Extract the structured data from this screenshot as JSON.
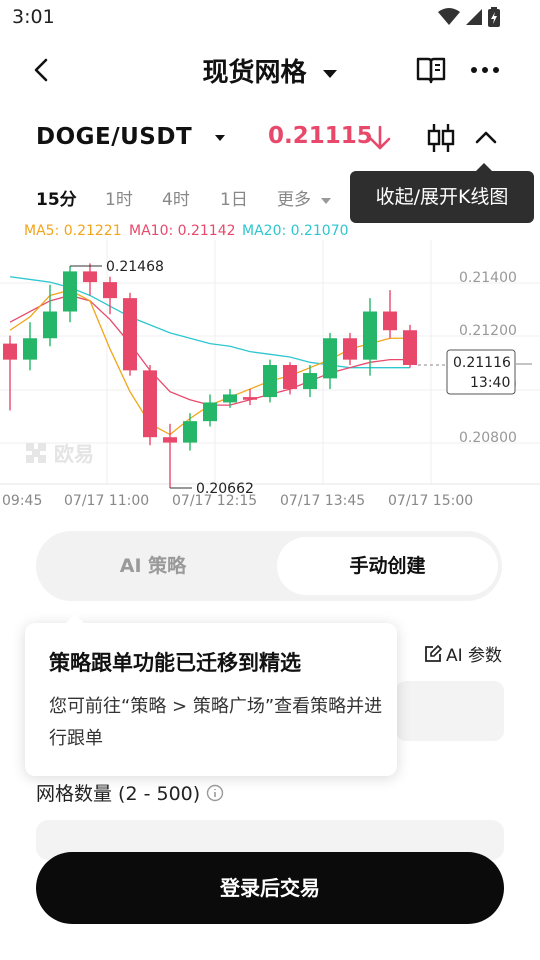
{
  "status_bar": {
    "time": "3:01"
  },
  "header": {
    "title": "现货网格"
  },
  "pair_bar": {
    "pair": "DOGE/USDT",
    "price": "0.21115"
  },
  "timeframes": {
    "tf_15m": "15分",
    "tf_1h": "1时",
    "tf_4h": "4时",
    "tf_1d": "1日",
    "more": "更多"
  },
  "tooltip": {
    "text": "收起/展开K线图"
  },
  "indicators": {
    "ma5": "MA5: 0.21221",
    "ma10": "MA10: 0.21142",
    "ma20": "MA20: 0.21070"
  },
  "colors": {
    "up": "#25b669",
    "down": "#e8496b",
    "ma5": "#f2a51a",
    "ma10": "#e8496b",
    "ma20": "#2ec6d0"
  },
  "chart_data": {
    "type": "candlestick",
    "y_ticks": [
      "0.21400",
      "0.21200",
      "0.21100",
      "0.20800"
    ],
    "x_ticks": [
      "09:45",
      "07/17 11:00",
      "07/17 12:15",
      "07/17 13:45",
      "07/17 15:00"
    ],
    "high_label": "0.21468",
    "low_label": "0.20662",
    "current_price": "0.21116",
    "current_countdown": "13:40",
    "watermark": "欧易",
    "ylim": [
      0.2069,
      0.2155
    ],
    "candles": [
      {
        "o": 0.212,
        "c": 0.2114,
        "h": 0.2123,
        "l": 0.2095
      },
      {
        "o": 0.2114,
        "c": 0.2122,
        "h": 0.2128,
        "l": 0.211
      },
      {
        "o": 0.2122,
        "c": 0.2132,
        "h": 0.2142,
        "l": 0.2119
      },
      {
        "o": 0.2132,
        "c": 0.2147,
        "h": 0.2149,
        "l": 0.2128
      },
      {
        "o": 0.2147,
        "c": 0.2143,
        "h": 0.215,
        "l": 0.2138
      },
      {
        "o": 0.2143,
        "c": 0.2137,
        "h": 0.2145,
        "l": 0.2131
      },
      {
        "o": 0.2137,
        "c": 0.211,
        "h": 0.2139,
        "l": 0.2108
      },
      {
        "o": 0.211,
        "c": 0.2085,
        "h": 0.2112,
        "l": 0.2082
      },
      {
        "o": 0.2085,
        "c": 0.2083,
        "h": 0.209,
        "l": 0.2066
      },
      {
        "o": 0.2083,
        "c": 0.2091,
        "h": 0.2094,
        "l": 0.208
      },
      {
        "o": 0.2091,
        "c": 0.2098,
        "h": 0.2101,
        "l": 0.2089
      },
      {
        "o": 0.2098,
        "c": 0.2101,
        "h": 0.2103,
        "l": 0.2096
      },
      {
        "o": 0.21,
        "c": 0.2099,
        "h": 0.2103,
        "l": 0.2097
      },
      {
        "o": 0.21,
        "c": 0.2112,
        "h": 0.2114,
        "l": 0.2098
      },
      {
        "o": 0.2112,
        "c": 0.2103,
        "h": 0.2113,
        "l": 0.2101
      },
      {
        "o": 0.2103,
        "c": 0.2109,
        "h": 0.2112,
        "l": 0.21
      },
      {
        "o": 0.2107,
        "c": 0.2122,
        "h": 0.2124,
        "l": 0.2103
      },
      {
        "o": 0.2122,
        "c": 0.2114,
        "h": 0.2124,
        "l": 0.2112
      },
      {
        "o": 0.2114,
        "c": 0.2132,
        "h": 0.2137,
        "l": 0.2108
      },
      {
        "o": 0.2132,
        "c": 0.2125,
        "h": 0.214,
        "l": 0.2122
      },
      {
        "o": 0.2125,
        "c": 0.2112,
        "h": 0.2127,
        "l": 0.2111
      }
    ],
    "ma5": [
      0.2125,
      0.213,
      0.2138,
      0.214,
      0.2136,
      0.2118,
      0.2102,
      0.209,
      0.2086,
      0.2092,
      0.2097,
      0.21,
      0.2103,
      0.2106,
      0.2108,
      0.2111,
      0.2114,
      0.2118,
      0.212,
      0.2122,
      0.2122
    ],
    "ma10": [
      0.2128,
      0.2132,
      0.2136,
      0.2138,
      0.2136,
      0.2129,
      0.212,
      0.211,
      0.2102,
      0.2099,
      0.2097,
      0.2097,
      0.2099,
      0.2101,
      0.2103,
      0.2106,
      0.2109,
      0.2111,
      0.2113,
      0.2114,
      0.2114
    ],
    "ma20": [
      0.2145,
      0.2144,
      0.2143,
      0.2141,
      0.2138,
      0.2134,
      0.213,
      0.2127,
      0.2124,
      0.2122,
      0.212,
      0.2119,
      0.2117,
      0.2116,
      0.2115,
      0.2113,
      0.2112,
      0.2111,
      0.2111,
      0.2111,
      0.2111
    ]
  },
  "strategy_tabs": {
    "ai": "AI 策略",
    "manual": "手动创建"
  },
  "ai_params": {
    "label": "AI 参数"
  },
  "popover": {
    "title": "策略跟单功能已迁移到精选",
    "body": "您可前往“策略 > 策略广场”查看策略并进行跟单"
  },
  "form": {
    "grid_count_label": "网格数量 (2 - 500)"
  },
  "cta": {
    "label": "登录后交易"
  }
}
